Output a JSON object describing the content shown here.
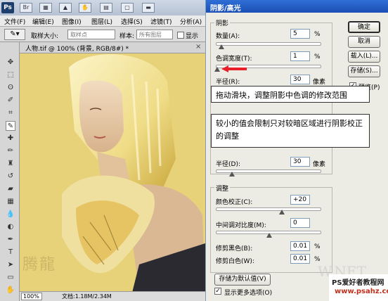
{
  "app": {
    "logo": "Ps",
    "zoom_icon": "zoom-icon",
    "menu": [
      "文件(F)",
      "编辑(E)",
      "图像(I)",
      "图层(L)",
      "选择(S)",
      "滤镜(T)",
      "分析(A)"
    ]
  },
  "options": {
    "sample_size_label": "取样大小:",
    "sample_size_value": "取样点",
    "sample_label": "样本:",
    "sample_value": "所有图层",
    "show_ring_label": "显示"
  },
  "document": {
    "tab_title": "人物.tif @ 100% (背景, RGB/8#) *",
    "zoom": "100%",
    "status": "文档:1.18M/2.34M"
  },
  "dialog": {
    "title": "阴影/高光",
    "shadows": {
      "group_label": "阴影",
      "amount_label": "数量(A):",
      "amount_value": "5",
      "amount_unit": "%",
      "amount_level": 0.05,
      "tonal_width_label": "色调宽度(T):",
      "tonal_width_value": "1",
      "tonal_width_unit": "%",
      "tonal_width_level": 0.01,
      "radius_label": "半径(R):",
      "radius_value": "30",
      "radius_unit": "像素"
    },
    "highlights": {
      "radius_label": "半径(D):",
      "radius_value": "30",
      "radius_unit": "像素"
    },
    "adjustments": {
      "group_label": "调整",
      "color_correction_label": "颜色校正(C):",
      "color_correction_value": "+20",
      "midtone_contrast_label": "中间调对比度(M):",
      "midtone_contrast_value": "0",
      "black_clip_label": "修剪黑色(B):",
      "black_clip_value": "0.01",
      "black_clip_unit": "%",
      "white_clip_label": "修剪白色(W):",
      "white_clip_value": "0.01",
      "white_clip_unit": "%"
    },
    "save_default_label": "存储为默认值(V)",
    "show_more_label": "显示更多选项(O)",
    "buttons": {
      "ok": "确定",
      "cancel": "取消",
      "load": "载入(L)...",
      "save": "存储(S)...",
      "preview": "预览(P)"
    }
  },
  "callouts": {
    "first": "拖动滑块，调整阴影中色调的修改范围",
    "second": "较小的值会限制只对较暗区域进行阴影校正的调整"
  },
  "watermarks": {
    "left": "腾龍",
    "right": "W.NET"
  },
  "branding": {
    "line1": "PS爱好者教程网",
    "line2": "www.psahz.com"
  },
  "colors": {
    "canvas_bg": "#e7d27a",
    "title_bar": "#1b4fb5",
    "arrow": "#e8202a"
  }
}
